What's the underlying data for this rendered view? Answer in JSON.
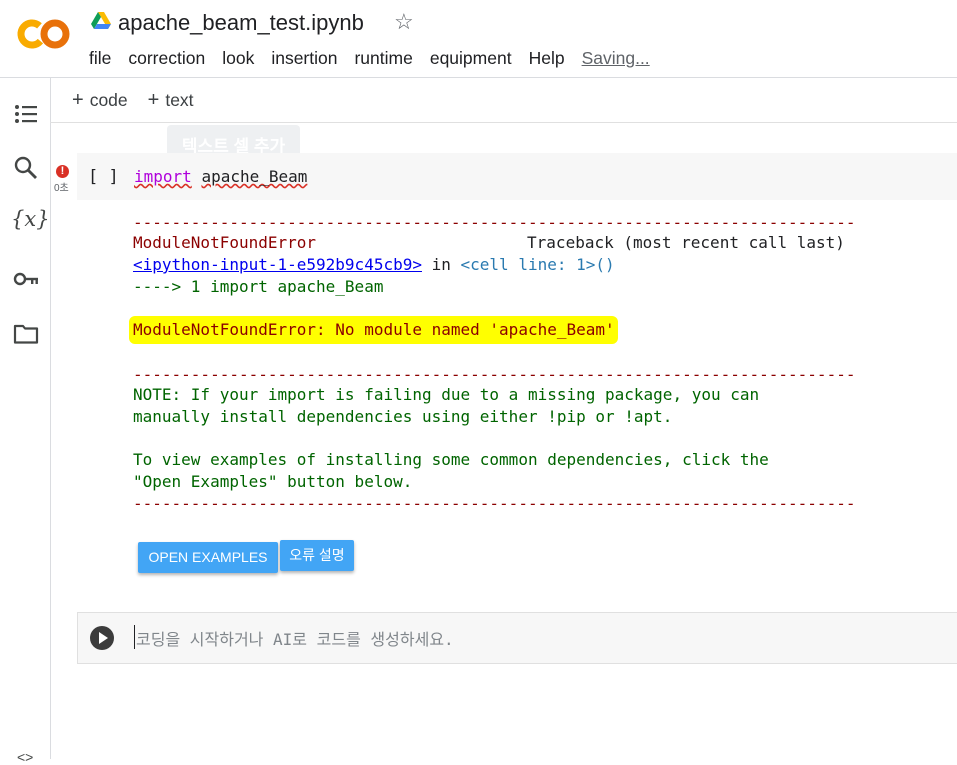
{
  "header": {
    "title": "apache_beam_test.ipynb",
    "logo_text": "CO",
    "menu": [
      "file",
      "correction",
      "look",
      "insertion",
      "runtime",
      "equipment",
      "Help"
    ],
    "saving_status": "Saving..."
  },
  "toolbar": {
    "add_code": "code",
    "add_text": "text",
    "tooltip": "텍스트 셀 추가"
  },
  "cell1": {
    "execution_count": "[ ]",
    "exec_time": "0초",
    "code_keyword": "import",
    "code_module": "apache_Beam",
    "output": {
      "dash": "---------------------------------------------------------------------------",
      "error_name": "ModuleNotFoundError",
      "traceback_label": "Traceback (most recent call last)",
      "input_link": "<ipython-input-1-e592b9c45cb9>",
      "in_text": " in ",
      "cell_line": "<cell line: 1>",
      "paren": "()",
      "arrow_line": "----> 1 import apache_Beam",
      "error_message": "ModuleNotFoundError: No module named 'apache_Beam'",
      "note_line1": "NOTE: If your import is failing due to a missing package, you can",
      "note_line2": "manually install dependencies using either !pip or !apt.",
      "view_line1": "To view examples of installing some common dependencies, click the",
      "view_line2": "\"Open Examples\" button below."
    },
    "buttons": {
      "open_examples": "OPEN EXAMPLES",
      "explain_error": "오류 설명"
    }
  },
  "cell2": {
    "placeholder": "코딩을 시작하거나 AI로 코드를 생성하세요."
  },
  "colors": {
    "highlight": "#ffff00",
    "button_blue": "#42a5f5",
    "error_red": "#8b0000",
    "note_green": "#006400"
  }
}
